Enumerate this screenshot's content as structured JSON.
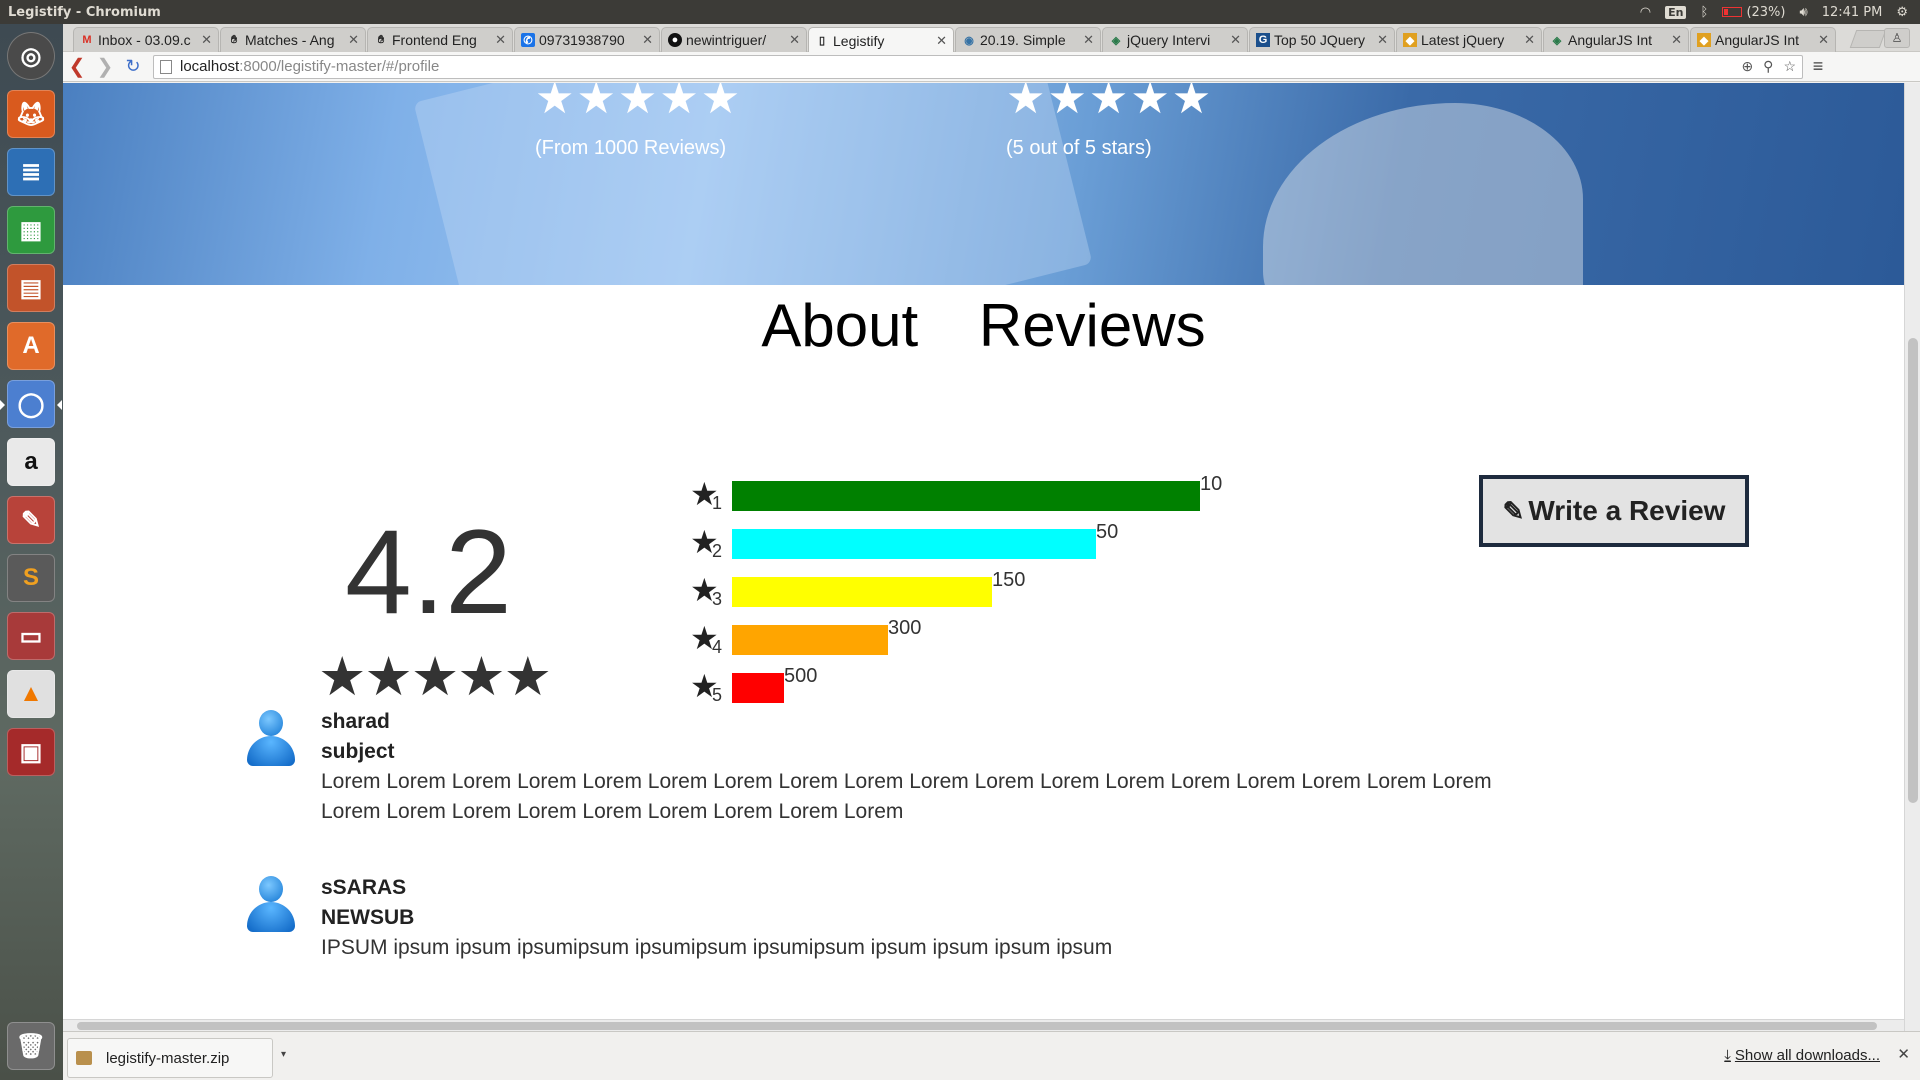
{
  "os": {
    "window_title": "Legistify - Chromium",
    "language": "En",
    "battery_text": "(23%)",
    "clock": "12:41 PM"
  },
  "browser": {
    "tabs": [
      {
        "label": "Inbox - 03.09.c",
        "icon": "gmail-icon",
        "active": false
      },
      {
        "label": "Matches - Ang",
        "icon": "hand-icon",
        "active": false
      },
      {
        "label": "Frontend Eng",
        "icon": "hand-icon",
        "active": false
      },
      {
        "label": "09731938790",
        "icon": "phone-icon",
        "active": false
      },
      {
        "label": "newintriguer/",
        "icon": "github-icon",
        "active": false
      },
      {
        "label": "Legistify",
        "icon": "page-icon",
        "active": true
      },
      {
        "label": "20.19. Simple",
        "icon": "python-icon",
        "active": false
      },
      {
        "label": "jQuery Intervi",
        "icon": "diamond-icon",
        "active": false
      },
      {
        "label": "Top 50 JQuery",
        "icon": "g-icon",
        "active": false
      },
      {
        "label": "Latest jQuery",
        "icon": "badge-icon",
        "active": false
      },
      {
        "label": "AngularJS Int",
        "icon": "diamond-icon",
        "active": false
      },
      {
        "label": "AngularJS Int",
        "icon": "badge-icon",
        "active": false
      }
    ],
    "url_host": "localhost",
    "url_rest": ":8000/legistify-master/#/profile"
  },
  "hero": {
    "left_stars": "★★★★★",
    "left_caption": "(From 1000 Reviews)",
    "right_stars": "★★★★★",
    "right_caption": "(5 out of 5 stars)"
  },
  "page_tabs": {
    "about": "About",
    "reviews": "Reviews"
  },
  "rating": {
    "average": "4.2",
    "stars": "★★★★★"
  },
  "chart_data": {
    "type": "bar",
    "categories": [
      "1",
      "2",
      "3",
      "4",
      "5"
    ],
    "values": [
      10,
      50,
      150,
      300,
      500
    ],
    "colors": [
      "#008000",
      "#00ffff",
      "#ffff00",
      "#ffa500",
      "#ff0000"
    ],
    "fill_fraction": [
      1.0,
      0.778,
      0.556,
      0.333,
      0.111
    ]
  },
  "write_review": {
    "label": "Write a Review"
  },
  "reviews": [
    {
      "name": "sharad",
      "subject": "subject",
      "body": "Lorem Lorem Lorem Lorem Lorem Lorem Lorem Lorem Lorem Lorem Lorem Lorem Lorem Lorem Lorem Lorem Lorem Lorem Lorem Lorem Lorem Lorem Lorem Lorem Lorem Lorem Lorem"
    },
    {
      "name": "sSARAS",
      "subject": "NEWSUB",
      "body": "IPSUM ipsum ipsum ipsumipsum ipsumipsum ipsumipsum ipsum ipsum ipsum ipsum"
    }
  ],
  "downloads": {
    "file": "legistify-master.zip",
    "show_all": "Show all downloads..."
  }
}
